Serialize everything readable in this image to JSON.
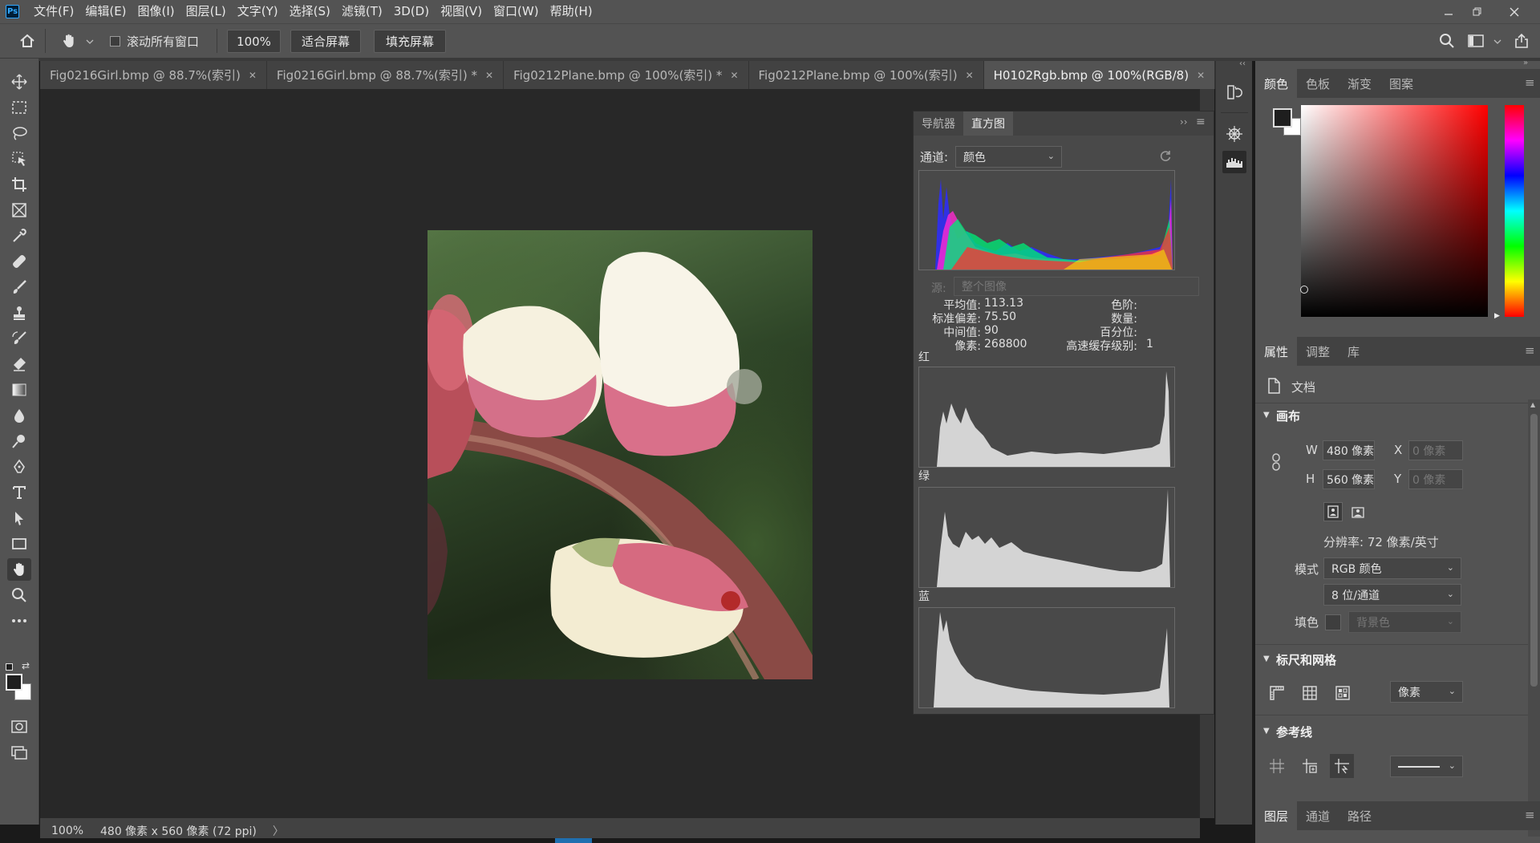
{
  "menubar": {
    "items": [
      "文件(F)",
      "编辑(E)",
      "图像(I)",
      "图层(L)",
      "文字(Y)",
      "选择(S)",
      "滤镜(T)",
      "3D(D)",
      "视图(V)",
      "窗口(W)",
      "帮助(H)"
    ],
    "logo": "Ps"
  },
  "options": {
    "scroll_all": "滚动所有窗口",
    "zoom": "100%",
    "fit_screen": "适合屏幕",
    "fill_screen": "填充屏幕"
  },
  "tabs": [
    {
      "label": "Fig0216Girl.bmp @ 88.7%(索引)",
      "active": false
    },
    {
      "label": "Fig0216Girl.bmp @ 88.7%(索引) *",
      "active": false
    },
    {
      "label": "Fig0212Plane.bmp @ 100%(索引) *",
      "active": false
    },
    {
      "label": "Fig0212Plane.bmp @ 100%(索引)",
      "active": false
    },
    {
      "label": "H0102Rgb.bmp @ 100%(RGB/8)",
      "active": true
    }
  ],
  "status": {
    "zoom": "100%",
    "doc_info": "480 像素 x 560 像素 (72 ppi)",
    "arrow": "〉"
  },
  "histogram_panel": {
    "tab_navigator": "导航器",
    "tab_histogram": "直方图",
    "channel_label": "通道:",
    "channel_value": "颜色",
    "source_label": "源:",
    "source_value": "整个图像",
    "stats_left": [
      {
        "label": "平均值:",
        "value": "113.13"
      },
      {
        "label": "标准偏差:",
        "value": "75.50"
      },
      {
        "label": "中间值:",
        "value": "90"
      },
      {
        "label": "像素:",
        "value": "268800"
      }
    ],
    "stats_right": [
      {
        "label": "色阶:",
        "value": ""
      },
      {
        "label": "数量:",
        "value": ""
      },
      {
        "label": "百分位:",
        "value": ""
      },
      {
        "label": "高速缓存级别:",
        "value": "1"
      }
    ],
    "red_label": "红",
    "green_label": "绿",
    "blue_label": "蓝"
  },
  "color_panel": {
    "tabs": [
      "颜色",
      "色板",
      "渐变",
      "图案"
    ],
    "hue_color": "#ff0000"
  },
  "properties_panel": {
    "tabs": [
      "属性",
      "调整",
      "库"
    ],
    "doc_label": "文档",
    "canvas_section": "画布",
    "w_label": "W",
    "w_value": "480 像素",
    "x_label": "X",
    "x_placeholder": "0 像素",
    "h_label": "H",
    "h_value": "560 像素",
    "y_label": "Y",
    "y_placeholder": "0 像素",
    "resolution": "分辨率: 72 像素/英寸",
    "mode_label": "模式",
    "mode_value": "RGB 颜色",
    "depth_value": "8 位/通道",
    "fill_label": "填色",
    "fill_value": "背景色",
    "rulers_section": "标尺和网格",
    "units_value": "像素",
    "guides_section": "参考线"
  },
  "layers_panel": {
    "tabs": [
      "图层",
      "通道",
      "路径"
    ]
  }
}
